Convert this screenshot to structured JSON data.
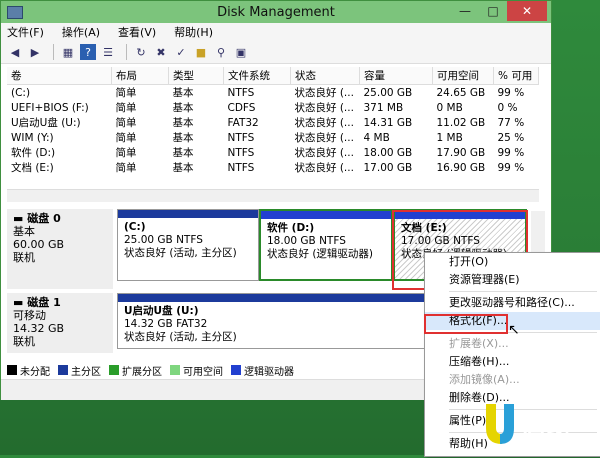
{
  "window": {
    "title": "Disk Management"
  },
  "menu": [
    "文件(F)",
    "操作(A)",
    "查看(V)",
    "帮助(H)"
  ],
  "toolbar_icons": [
    "back-icon",
    "forward-icon",
    "properties-icon",
    "help-icon",
    "list-icon",
    "refresh-icon",
    "delete-icon",
    "check-icon",
    "folder-open-icon",
    "search-icon",
    "export-icon"
  ],
  "volumes": {
    "headers": [
      "卷",
      "布局",
      "类型",
      "文件系统",
      "状态",
      "容量",
      "可用空间",
      "% 可用"
    ],
    "rows": [
      [
        "(C:)",
        "简单",
        "基本",
        "NTFS",
        "状态良好 (...",
        "25.00 GB",
        "24.65 GB",
        "99 %"
      ],
      [
        "UEFI+BIOS (F:)",
        "简单",
        "基本",
        "CDFS",
        "状态良好 (...",
        "371 MB",
        "0 MB",
        "0 %"
      ],
      [
        "U启动U盘 (U:)",
        "简单",
        "基本",
        "FAT32",
        "状态良好 (...",
        "14.31 GB",
        "11.02 GB",
        "77 %"
      ],
      [
        "WIM (Y:)",
        "简单",
        "基本",
        "NTFS",
        "状态良好 (...",
        "4 MB",
        "1 MB",
        "25 %"
      ],
      [
        "软件 (D:)",
        "简单",
        "基本",
        "NTFS",
        "状态良好 (...",
        "18.00 GB",
        "17.90 GB",
        "99 %"
      ],
      [
        "文档 (E:)",
        "简单",
        "基本",
        "NTFS",
        "状态良好 (...",
        "17.00 GB",
        "16.90 GB",
        "99 %"
      ]
    ]
  },
  "disk0": {
    "name": "磁盘 0",
    "type": "基本",
    "size": "60.00 GB",
    "status": "联机",
    "partitions": [
      {
        "title": "(C:)",
        "detail": "25.00 GB NTFS",
        "status": "状态良好 (活动, 主分区)"
      },
      {
        "title": "软件 (D:)",
        "detail": "18.00 GB NTFS",
        "status": "状态良好 (逻辑驱动器)"
      },
      {
        "title": "文档 (E:)",
        "detail": "17.00 GB NTFS",
        "status": "状态良好 (逻辑驱动器)"
      }
    ]
  },
  "disk1": {
    "name": "磁盘 1",
    "type": "可移动",
    "size": "14.32 GB",
    "status": "联机",
    "partition": {
      "title": "U启动U盘 (U:)",
      "detail": "14.32 GB FAT32",
      "status": "状态良好 (活动, 主分区)"
    }
  },
  "legend": [
    {
      "label": "未分配",
      "color": "#000000"
    },
    {
      "label": "主分区",
      "color": "#1c3a9c"
    },
    {
      "label": "扩展分区",
      "color": "#2a9d2a"
    },
    {
      "label": "可用空间",
      "color": "#7fd67f"
    },
    {
      "label": "逻辑驱动器",
      "color": "#2240d0"
    }
  ],
  "context_menu": [
    {
      "label": "打开(O)",
      "disabled": false
    },
    {
      "label": "资源管理器(E)",
      "disabled": false
    },
    {
      "sep": true
    },
    {
      "label": "更改驱动器号和路径(C)...",
      "disabled": false
    },
    {
      "label": "格式化(F)...",
      "disabled": false,
      "highlight": true
    },
    {
      "sep": true
    },
    {
      "label": "扩展卷(X)...",
      "disabled": true
    },
    {
      "label": "压缩卷(H)...",
      "disabled": false
    },
    {
      "label": "添加镜像(A)...",
      "disabled": true
    },
    {
      "label": "删除卷(D)...",
      "disabled": false
    },
    {
      "sep": true
    },
    {
      "label": "属性(P)",
      "disabled": false
    },
    {
      "sep": true
    },
    {
      "label": "帮助(H)",
      "disabled": false
    }
  ],
  "logo": {
    "text": "U启动",
    "url": "WWW.UQIDONG.COM"
  }
}
